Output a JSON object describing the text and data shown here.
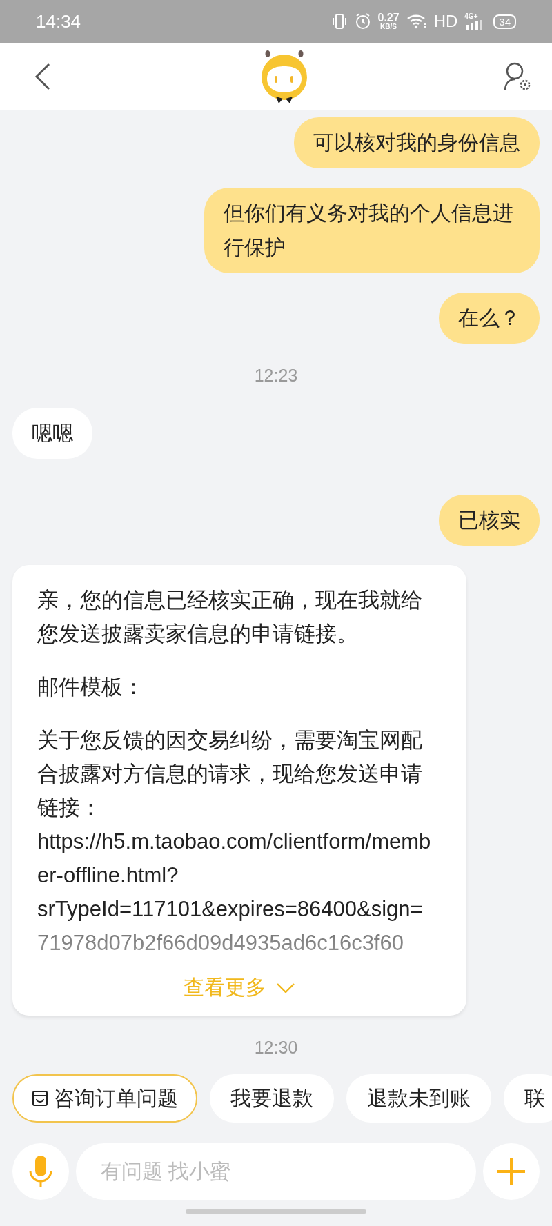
{
  "status_bar": {
    "time": "14:34",
    "speed": "0.27",
    "speed_unit": "KB/S",
    "network": "HD",
    "signal": "4G+",
    "battery": "34"
  },
  "messages": [
    {
      "kind": "sent",
      "text": "可以核对我的身份信息"
    },
    {
      "kind": "sent",
      "text": "但你们有义务对我的个人信息进行保护"
    },
    {
      "kind": "sent",
      "text": "在么？"
    },
    {
      "kind": "time",
      "text": "12:23"
    },
    {
      "kind": "received",
      "text": "嗯嗯"
    },
    {
      "kind": "sent",
      "text": "已核实"
    },
    {
      "kind": "card",
      "paragraphs": [
        "亲，您的信息已经核实正确，现在我就给您发送披露卖家信息的申请链接。",
        "邮件模板：",
        "关于您反馈的因交易纠纷，需要淘宝网配合披露对方信息的请求，现给您发送申请链接：\nhttps://h5.m.taobao.com/clientform/member-offline.html?srTypeId=117101&expires=86400&sign=71978d07b2f66d09d4935ad6c16c3f60"
      ],
      "more": "查看更多"
    },
    {
      "kind": "time",
      "text": "12:30"
    }
  ],
  "quick_replies": [
    {
      "label": "咨询订单问题",
      "selected": true
    },
    {
      "label": "我要退款",
      "selected": false
    },
    {
      "label": "退款未到账",
      "selected": false
    },
    {
      "label": "联",
      "selected": false
    }
  ],
  "input": {
    "placeholder": "有问题 找小蜜"
  }
}
